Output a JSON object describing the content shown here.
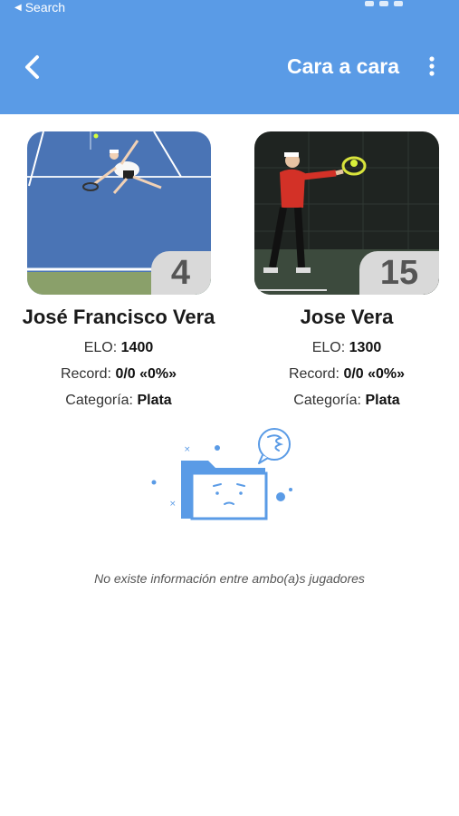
{
  "status_bar": {
    "back_label": "Search"
  },
  "header": {
    "title": "Cara a cara",
    "back_icon": "chevron-left-icon",
    "menu_icon": "vertical-dots-icon",
    "color": "#5a9be6"
  },
  "players": [
    {
      "name": "José Francisco Vera",
      "rank": "4",
      "elo_label": "ELO:",
      "elo": "1400",
      "record_label": "Record:",
      "record": "0/0 «0%»",
      "category_label": "Categoría:",
      "category": "Plata"
    },
    {
      "name": "Jose Vera",
      "rank": "15",
      "elo_label": "ELO:",
      "elo": "1300",
      "record_label": "Record:",
      "record": "0/0 «0%»",
      "category_label": "Categoría:",
      "category": "Plata"
    }
  ],
  "empty_state": {
    "illustration_icon": "sad-folder-icon",
    "message": "No existe información entre ambo(a)s jugadores"
  }
}
